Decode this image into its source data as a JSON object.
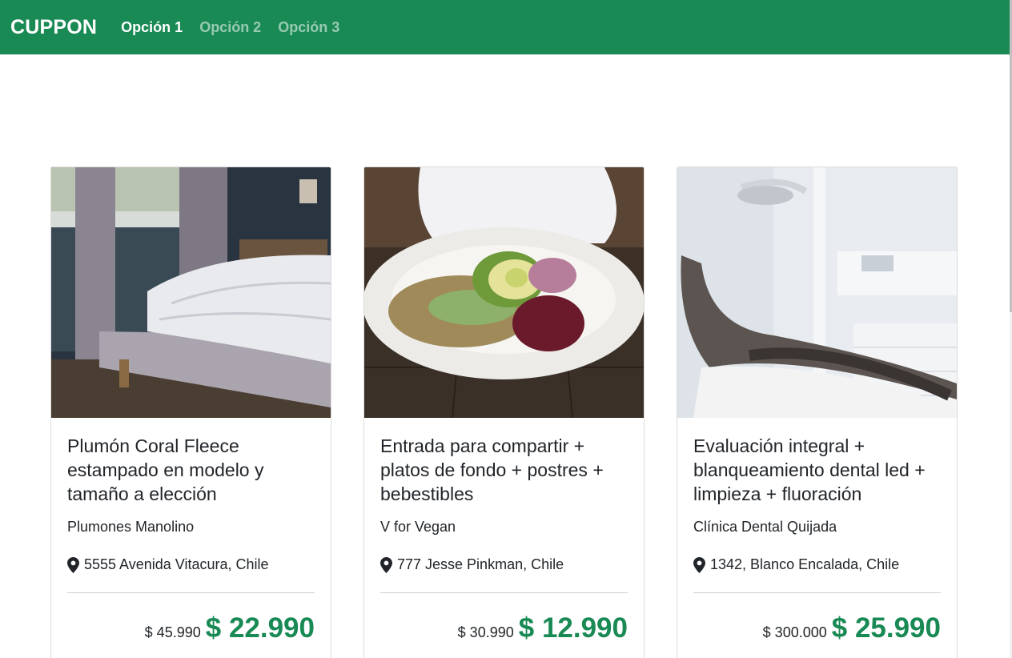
{
  "nav": {
    "brand": "CUPPON",
    "links": [
      "Opción 1",
      "Opción 2",
      "Opción 3"
    ]
  },
  "colors": {
    "brand": "#1a8a55",
    "text": "#212529"
  },
  "cards": [
    {
      "image": "bedroom-photo",
      "title": "Plumón Coral Fleece estampado en modelo y tamaño a elección",
      "merchant": "Plumones Manolino",
      "address": "5555 Avenida Vitacura, Chile",
      "old_price": "$ 45.990",
      "new_price": "$ 22.990"
    },
    {
      "image": "vegan-food-photo",
      "title": "Entrada para compartir + platos de fondo + postres + bebestibles",
      "merchant": "V for Vegan",
      "address": "777 Jesse Pinkman, Chile",
      "old_price": "$ 30.990",
      "new_price": "$ 12.990"
    },
    {
      "image": "dental-chair-photo",
      "title": "Evaluación integral + blanqueamiento dental led + limpieza + fluoración",
      "merchant": "Clínica Dental Quijada",
      "address": "1342, Blanco Encalada, Chile",
      "old_price": "$ 300.000",
      "new_price": "$ 25.990"
    }
  ]
}
